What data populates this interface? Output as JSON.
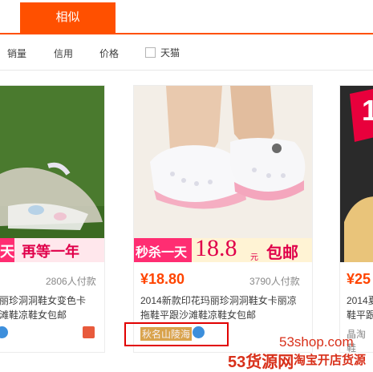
{
  "tabs": {
    "active_label": "相似"
  },
  "sort": {
    "sales_label": "销量",
    "credit_label": "信用",
    "price_label": "价格",
    "tmall_label": "天猫"
  },
  "cards": [
    {
      "banner_left": "天",
      "banner_right": "再等一年",
      "sales": "2806人付款",
      "title_line1": "丽珍洞洞鞋女变色卡",
      "title_line2": "滩鞋凉鞋女包邮"
    },
    {
      "banner_left": "秒杀一天",
      "banner_price": "18.8",
      "banner_unit": "元",
      "banner_right": "包邮",
      "price": "¥18.80",
      "sales": "3790人付款",
      "title_line1": "2014新款印花玛丽珍洞洞鞋女卡丽凉",
      "title_line2": "拖鞋平跟沙滩鞋凉鞋女包邮",
      "shop": "秋名山陵海"
    },
    {
      "banner_text": "1",
      "price": "¥25",
      "title_line1": "2014夏",
      "title_line2": "鞋平跟",
      "shop": "晶淘鞋"
    }
  ],
  "watermark": {
    "site": "53shop.com",
    "brand": "53货源网",
    "tagline": "淘宝开店货源"
  }
}
